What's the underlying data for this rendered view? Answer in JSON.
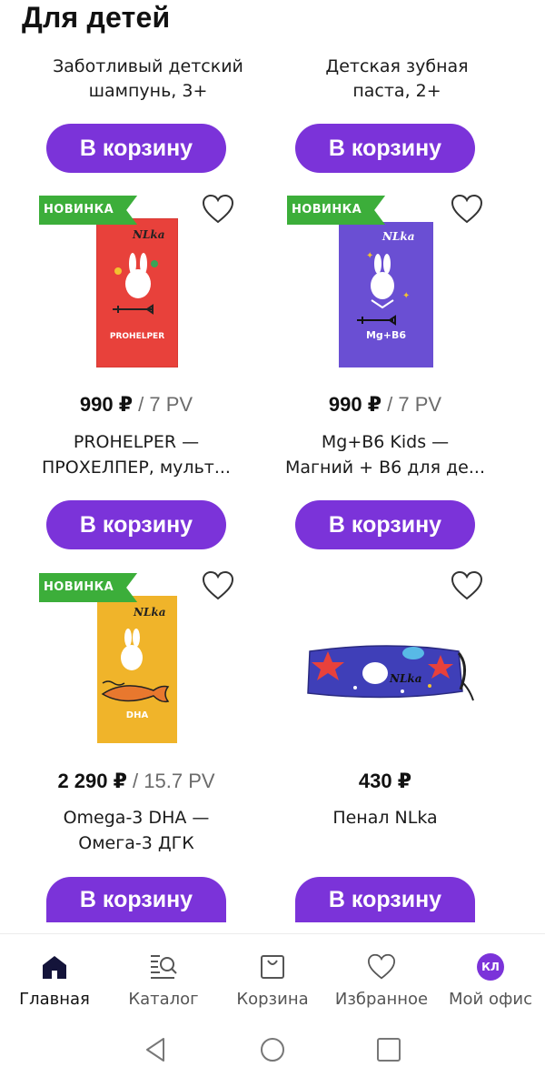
{
  "header": {
    "title": "Для детей"
  },
  "products_top": [
    {
      "name_line1": "Заботливый детский",
      "name_line2": "шампунь, 3+",
      "cart_label": "В корзину"
    },
    {
      "name_line1": "Детская зубная",
      "name_line2": "паста, 2+",
      "cart_label": "В корзину"
    }
  ],
  "products": [
    {
      "badge": "НОВИНКА",
      "price": "990 ₽",
      "pv": " / 7 PV",
      "name_line1": "PROHELPER —",
      "name_line2": "ПРОХЕЛПЕР, мульт...",
      "cart_label": "В корзину",
      "box_label": "PROHELPER",
      "box_color": "#e8413b"
    },
    {
      "badge": "НОВИНКА",
      "price": "990 ₽",
      "pv": " / 7 PV",
      "name_line1": "Mg+B6 Kids —",
      "name_line2": "Магний + B6 для де...",
      "cart_label": "В корзину",
      "box_label": "Mg+B6",
      "box_color": "#6a4fd3"
    },
    {
      "badge": "НОВИНКА",
      "price": "2 290 ₽",
      "pv": " / 15.7 PV",
      "name_line1": "Omega-3 DHA —",
      "name_line2": "Омега-3 ДГК",
      "cart_label": "В корзину",
      "box_label": "DHA",
      "box_color": "#f0b42a"
    },
    {
      "badge": "",
      "price": "430 ₽",
      "pv": "",
      "name_line1": "Пенал NLka",
      "name_line2": "",
      "cart_label": "В корзину",
      "box_label": "",
      "box_color": "#3f3fb8"
    }
  ],
  "bottom_nav": [
    {
      "label": "Главная",
      "icon": "home-icon",
      "active": true
    },
    {
      "label": "Каталог",
      "icon": "catalog-search-icon",
      "active": false
    },
    {
      "label": "Корзина",
      "icon": "cart-bag-icon",
      "active": false
    },
    {
      "label": "Избранное",
      "icon": "heart-icon",
      "active": false
    },
    {
      "label": "Мой офис",
      "icon": "avatar-icon",
      "active": false,
      "avatar_text": "КЛ"
    }
  ],
  "colors": {
    "accent": "#7b33d9",
    "badge": "#3cae3a"
  }
}
